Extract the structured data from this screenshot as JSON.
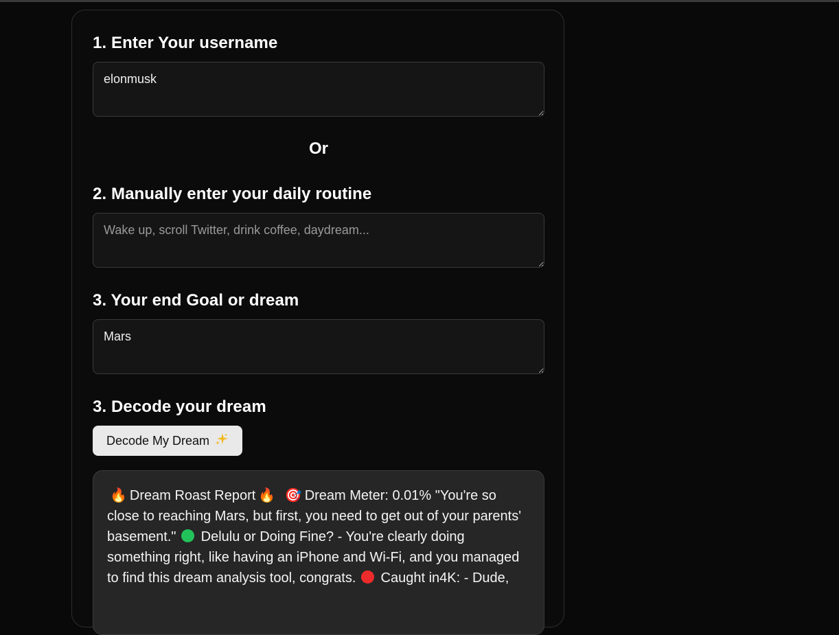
{
  "form": {
    "username_heading": "1. Enter Your username",
    "username_value": "elonmusk",
    "or_text": "Or",
    "routine_heading": "2. Manually enter your daily routine",
    "routine_value": "",
    "routine_placeholder": "Wake up, scroll Twitter, drink coffee, daydream...",
    "goal_heading": "3. Your end Goal or dream",
    "goal_value": "Mars",
    "decode_heading": "3. Decode your dream",
    "decode_button_label": "Decode My Dream",
    "decode_button_icon": "sparkles-icon"
  },
  "result": {
    "fire_icon": "🔥",
    "title": "Dream Roast Report",
    "target_icon": "🎯",
    "meter_text": "Dream Meter: 0.01% \"You're so close to reaching Mars, but first, you need to get out of your parents' basement.\"",
    "delulu_text": "Delulu or Doing Fine? - You're clearly doing something right, like having an iPhone and Wi-Fi, and you managed to find this dream analysis tool, congrats.",
    "caught_text": "Caught in4K: - Dude,",
    "colors": {
      "green": "#22c25a",
      "red": "#ee2b2b"
    }
  }
}
